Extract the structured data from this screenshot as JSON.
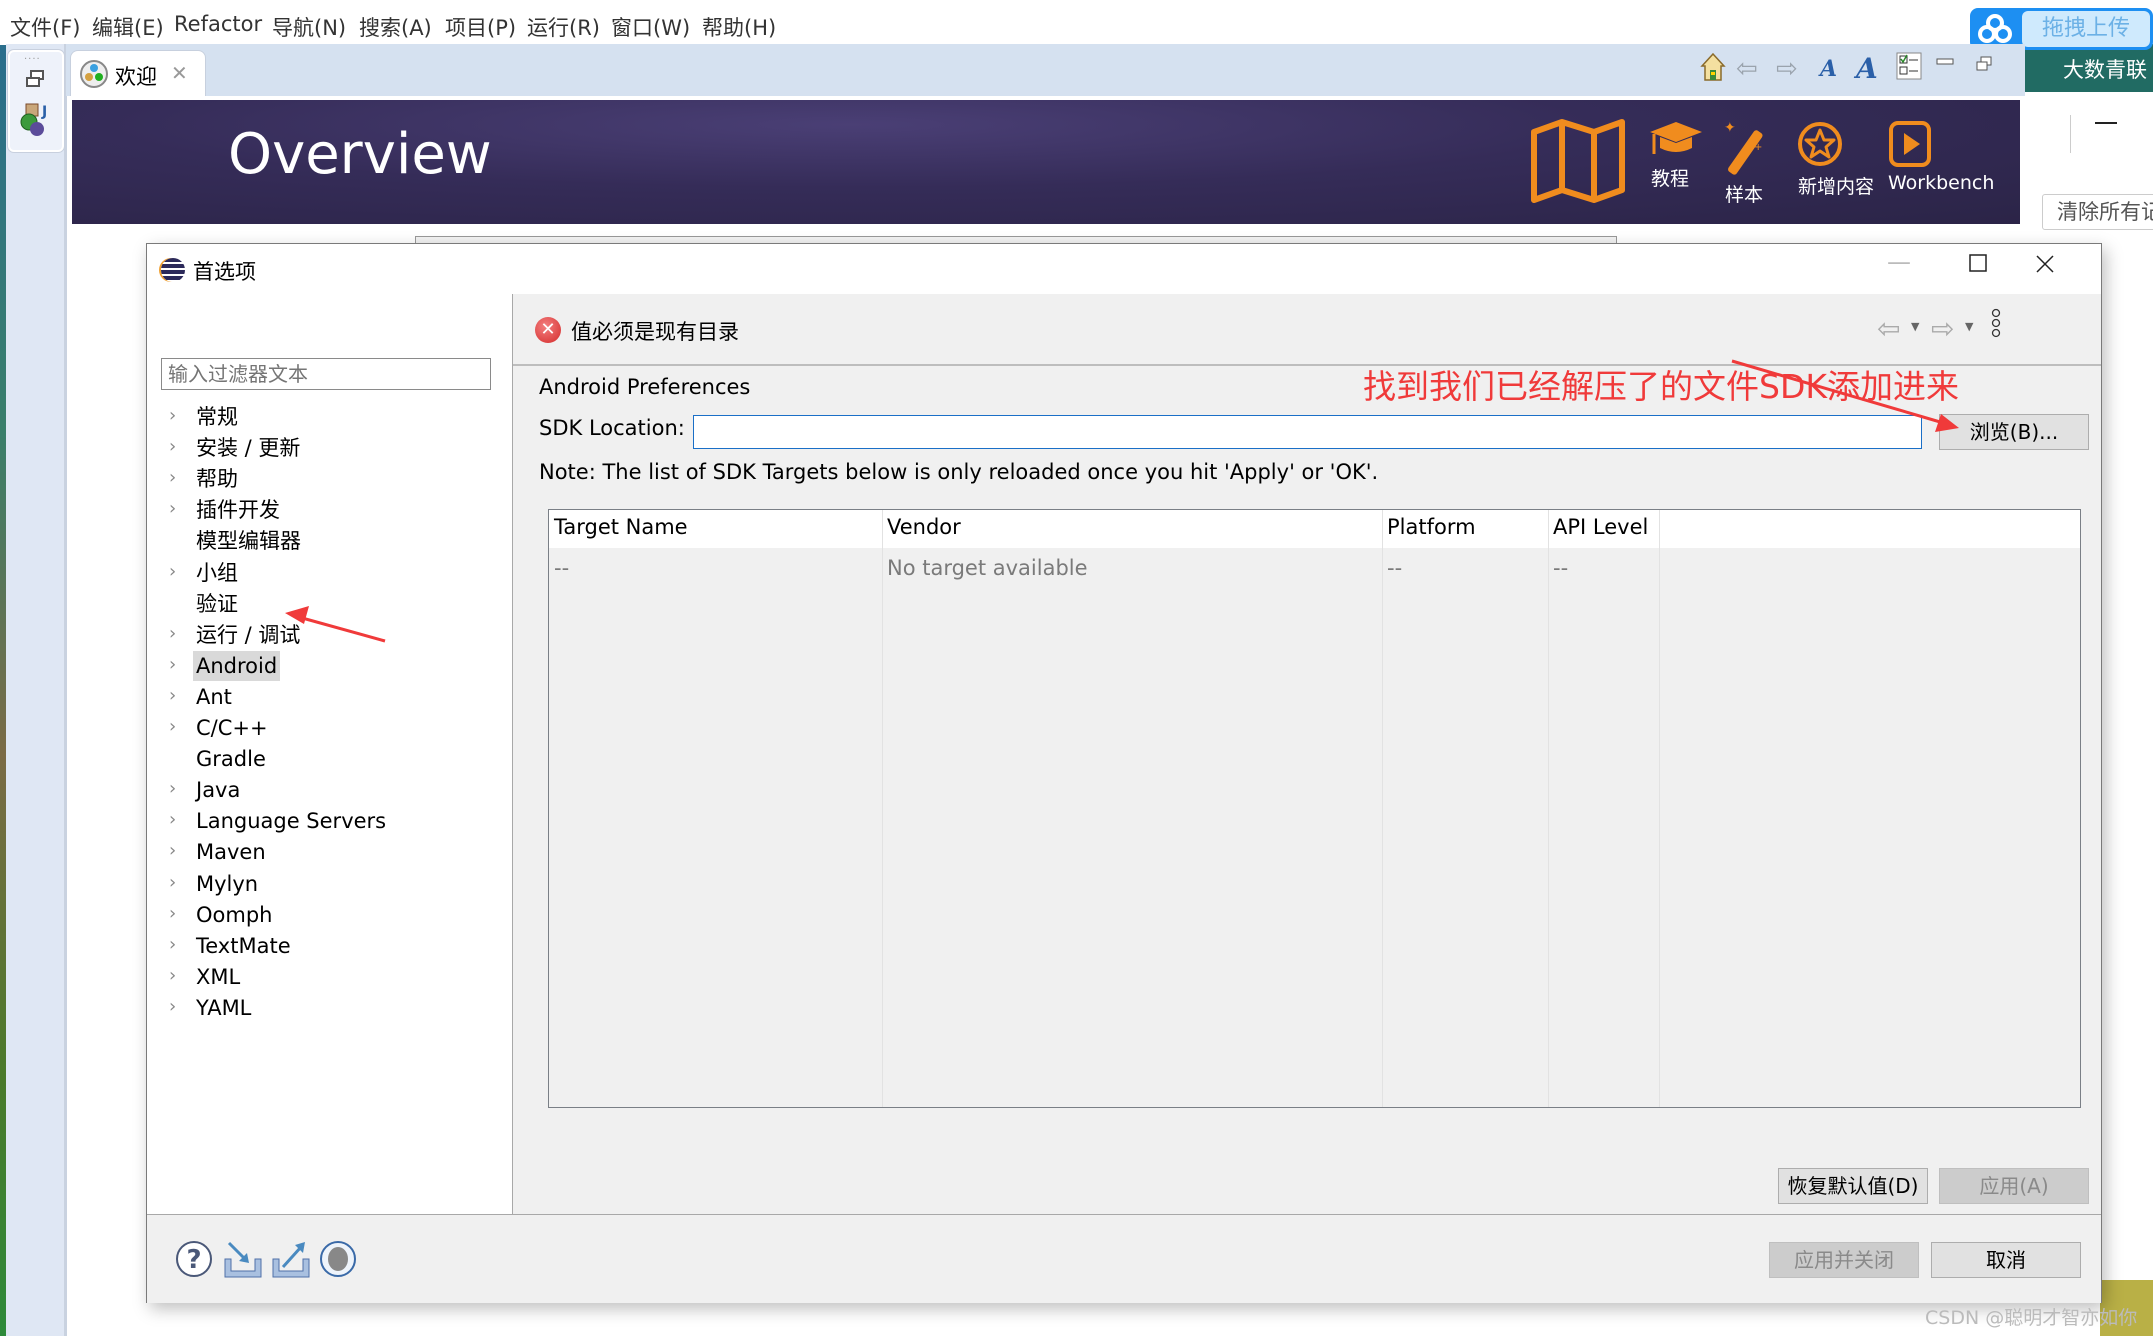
{
  "menubar": {
    "items": [
      "文件(F)",
      "编辑(E)",
      "Refactor",
      "导航(N)",
      "搜索(A)",
      "项目(P)",
      "运行(R)",
      "窗口(W)",
      "帮助(H)"
    ]
  },
  "upload_widget": {
    "label": "拖拽上传"
  },
  "background_app": {
    "title": "大数青联",
    "clear_button": "清除所有记"
  },
  "workbench": {
    "tab": {
      "label": "欢迎",
      "icon": "welcome-icon"
    },
    "banner": {
      "title": "Overview",
      "links": [
        {
          "label": "",
          "icon": "map-icon"
        },
        {
          "label": "教程",
          "icon": "graduation-cap-icon"
        },
        {
          "label": "样本",
          "icon": "magic-wand-icon"
        },
        {
          "label": "新增内容",
          "icon": "star-icon"
        },
        {
          "label": "Workbench",
          "icon": "play-icon"
        }
      ],
      "accent_color": "#f08c1e"
    },
    "toolbar_icons": [
      "home-icon",
      "back-icon",
      "forward-icon",
      "font-decrease-icon",
      "font-increase-icon",
      "customize-icon",
      "minimize-icon",
      "restore-icon"
    ]
  },
  "dialog": {
    "title": "首选项",
    "filter": {
      "placeholder": "输入过滤器文本",
      "value": ""
    },
    "tree": [
      {
        "label": "常规",
        "expandable": true
      },
      {
        "label": "安装 / 更新",
        "expandable": true
      },
      {
        "label": "帮助",
        "expandable": true
      },
      {
        "label": "插件开发",
        "expandable": true
      },
      {
        "label": "模型编辑器",
        "expandable": false
      },
      {
        "label": "小组",
        "expandable": true
      },
      {
        "label": "验证",
        "expandable": false
      },
      {
        "label": "运行 / 调试",
        "expandable": true
      },
      {
        "label": "Android",
        "expandable": true,
        "selected": true
      },
      {
        "label": "Ant",
        "expandable": true
      },
      {
        "label": "C/C++",
        "expandable": true
      },
      {
        "label": "Gradle",
        "expandable": false
      },
      {
        "label": "Java",
        "expandable": true
      },
      {
        "label": "Language Servers",
        "expandable": true
      },
      {
        "label": "Maven",
        "expandable": true
      },
      {
        "label": "Mylyn",
        "expandable": true
      },
      {
        "label": "Oomph",
        "expandable": true
      },
      {
        "label": "TextMate",
        "expandable": true
      },
      {
        "label": "XML",
        "expandable": true
      },
      {
        "label": "YAML",
        "expandable": true
      }
    ],
    "message": {
      "text": "值必须是现有目录",
      "type": "error"
    },
    "annotation": "找到我们已经解压了的文件SDK添加进来",
    "page": {
      "title": "Android Preferences",
      "sdk_label": "SDK Location:",
      "sdk_value": "",
      "browse_label": "浏览(B)...",
      "note": "Note: The list of SDK Targets below is only reloaded once you hit 'Apply' or 'OK'.",
      "table": {
        "columns": [
          "Target Name",
          "Vendor",
          "Platform",
          "API Level"
        ],
        "rows": [
          [
            "--",
            "No target available",
            "--",
            "--"
          ]
        ]
      },
      "restore_defaults": "恢复默认值(D)",
      "apply": "应用(A)"
    },
    "buttons": {
      "apply_and_close": "应用并关闭",
      "cancel": "取消"
    },
    "bottom_icons": [
      "help-icon",
      "import-icon",
      "export-icon",
      "record-icon"
    ]
  },
  "watermark": "CSDN @聪明才智亦如你"
}
